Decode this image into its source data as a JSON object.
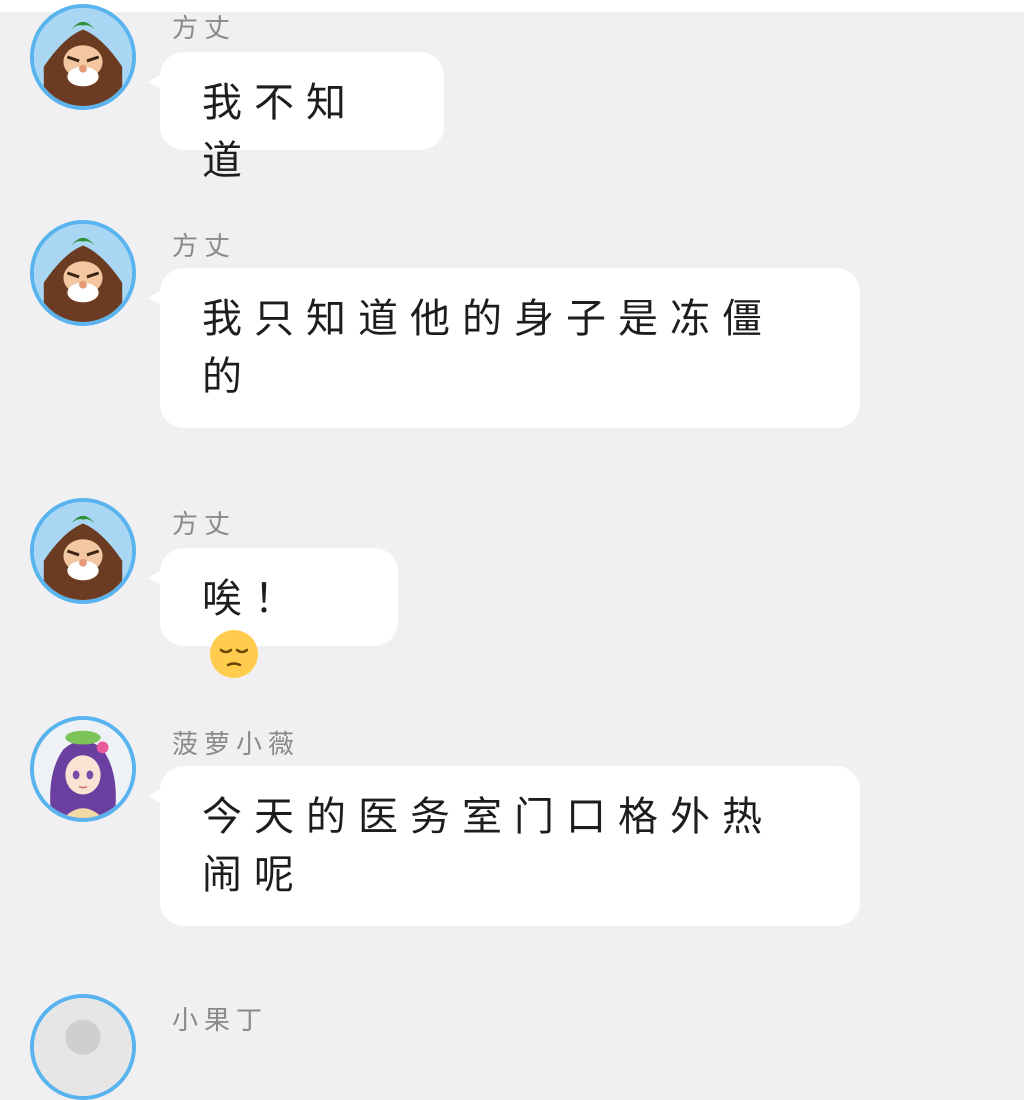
{
  "colors": {
    "background": "#f0f0f2",
    "bubble": "#ffffff",
    "avatar_ring": "#59b3ee",
    "sender_name": "#8a8a8a",
    "message_text": "#1d1d1d"
  },
  "messages": [
    {
      "sender": "方丈",
      "avatar_icon": "abbot-avatar-icon",
      "text": "我不知道"
    },
    {
      "sender": "方丈",
      "avatar_icon": "abbot-avatar-icon",
      "text": "我只知道他的身子是冻僵的"
    },
    {
      "sender": "方丈",
      "avatar_icon": "abbot-avatar-icon",
      "text": "唉！",
      "emoji": "pensive-face-emoji"
    },
    {
      "sender": "菠萝小薇",
      "avatar_icon": "girl-avatar-icon",
      "text": "今天的医务室门口格外热闹呢"
    },
    {
      "sender": "小果丁",
      "avatar_icon": "user-avatar-icon",
      "text": ""
    }
  ]
}
